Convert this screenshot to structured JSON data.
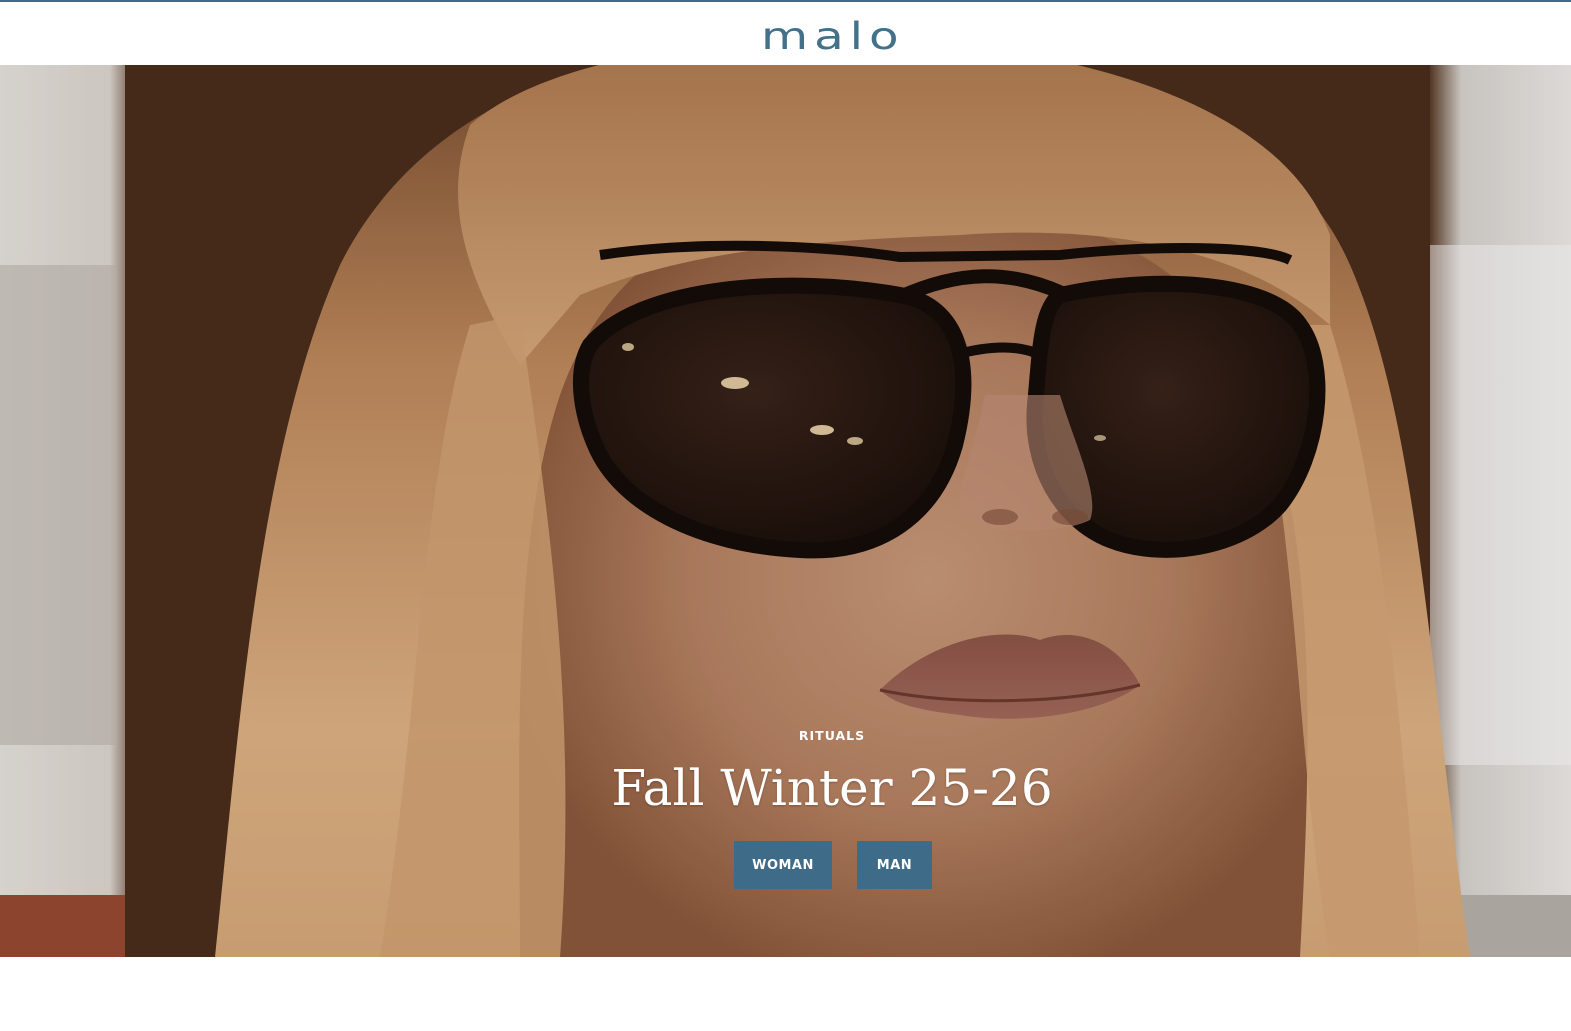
{
  "header": {
    "logo_text": "malo",
    "accent_color": "#3e6b85"
  },
  "hero": {
    "eyebrow": "RITUALS",
    "title": "Fall Winter 25-26",
    "buttons": {
      "woman_label": "WOMAN",
      "man_label": "MAN"
    },
    "button_color": "#3e6b87"
  }
}
